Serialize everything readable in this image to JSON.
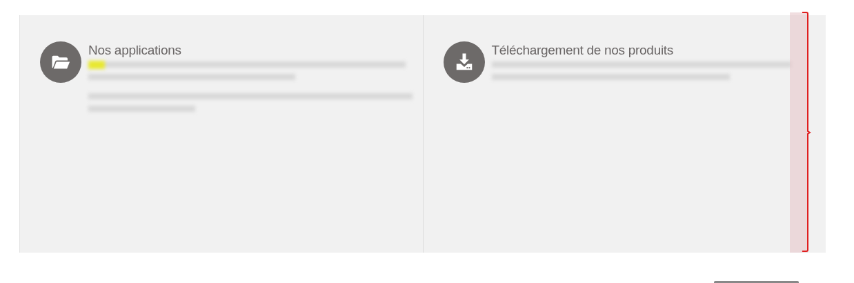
{
  "panels": [
    {
      "title": "Nos applications"
    },
    {
      "title": "Téléchargement de nos produits"
    }
  ]
}
